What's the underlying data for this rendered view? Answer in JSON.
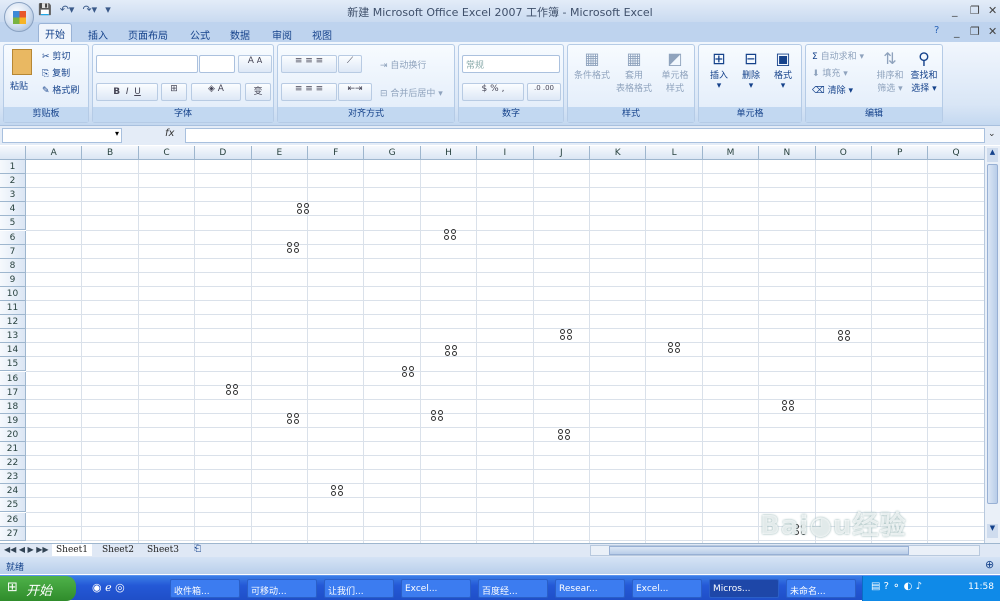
{
  "window": {
    "title": "新建 Microsoft Office Excel 2007 工作簿 - Microsoft Excel"
  },
  "ribbon_tabs": [
    "开始",
    "插入",
    "页面布局",
    "公式",
    "数据",
    "审阅",
    "视图"
  ],
  "clipboard": {
    "paste": "粘贴",
    "cut": "剪切",
    "copy": "复制",
    "format_painter": "格式刷",
    "label": "剪贴板"
  },
  "font": {
    "label": "字体",
    "bold": "B",
    "italic": "I",
    "underline": "U",
    "grow": "A",
    "shrink": "A"
  },
  "alignment": {
    "label": "对齐方式",
    "wrap": "自动换行",
    "merge": "合并后居中"
  },
  "number": {
    "label": "数字",
    "format": "常规",
    "percent": "%",
    "comma": ","
  },
  "styles": {
    "label": "样式",
    "conditional": "条件格式",
    "table1": "套用",
    "table2": "表格格式",
    "cell1": "单元格",
    "cell2": "样式"
  },
  "cells": {
    "label": "单元格",
    "insert": "插入",
    "delete": "删除",
    "format": "格式"
  },
  "editing": {
    "label": "编辑",
    "autosum": "自动求和",
    "fill": "填充",
    "clear": "清除",
    "sort1": "排序和",
    "sort2": "筛选",
    "find1": "查找和",
    "find2": "选择"
  },
  "formula": {
    "fx": "fx"
  },
  "columns": [
    "A",
    "B",
    "C",
    "D",
    "E",
    "F",
    "G",
    "H",
    "I",
    "J",
    "K",
    "L",
    "M",
    "N",
    "O",
    "P",
    "Q"
  ],
  "rows": [
    "1",
    "2",
    "3",
    "4",
    "5",
    "6",
    "7",
    "8",
    "9",
    "10",
    "11",
    "12",
    "13",
    "14",
    "15",
    "16",
    "17",
    "18",
    "19",
    "20",
    "21",
    "22",
    "23",
    "24",
    "25",
    "26",
    "27"
  ],
  "sheets": [
    "Sheet1",
    "Sheet2",
    "Sheet3"
  ],
  "status": {
    "ready": "就绪"
  },
  "taskbar": {
    "start": "开始",
    "tasks": [
      "收件箱...",
      "可移动...",
      "让我们...",
      "Excel...",
      "百度经...",
      "Resear...",
      "Excel...",
      "Micros...",
      "未命名..."
    ],
    "active_index": 7,
    "clock": "11:58"
  },
  "watermark": "Baidu经验 jingyan.baidu.com"
}
